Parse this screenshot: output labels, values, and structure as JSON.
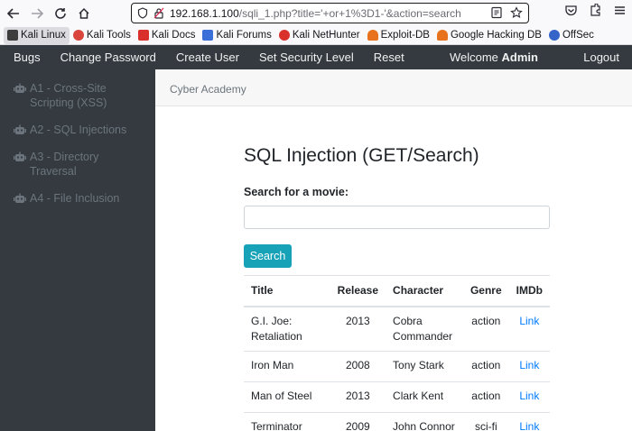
{
  "browser": {
    "url_host": "192.168.1.100",
    "url_rest": "/sqli_1.php?title='+or+1%3D1-'&action=search"
  },
  "bookmarks": [
    {
      "label": "Kali Linux",
      "color": "#3d3d3d",
      "active": true
    },
    {
      "label": "Kali Tools",
      "color": "#d9453d",
      "active": false
    },
    {
      "label": "Kali Docs",
      "color": "#d9302c",
      "active": false
    },
    {
      "label": "Kali Forums",
      "color": "#3b6fd8",
      "active": false
    },
    {
      "label": "Kali NetHunter",
      "color": "#d9302c",
      "active": false
    },
    {
      "label": "Exploit-DB",
      "color": "#e8731e",
      "active": false
    },
    {
      "label": "Google Hacking DB",
      "color": "#e8731e",
      "active": false
    },
    {
      "label": "OffSec",
      "color": "#3565c9",
      "active": false
    }
  ],
  "navbar": {
    "items": [
      "Bugs",
      "Change Password",
      "Create User",
      "Set Security Level",
      "Reset"
    ],
    "welcome_prefix": "Welcome",
    "welcome_user": "Admin",
    "logout": "Logout"
  },
  "sidebar": {
    "items": [
      "A1 - Cross-Site Scripting (XSS)",
      "A2 - SQL Injections",
      "A3 - Directory Traversal",
      "A4 - File Inclusion"
    ]
  },
  "content": {
    "header": "Cyber Academy",
    "title": "SQL Injection (GET/Search)",
    "search_label": "Search for a movie:",
    "search_value": "",
    "search_button": "Search"
  },
  "table": {
    "headers": [
      "Title",
      "Release",
      "Character",
      "Genre",
      "IMDb"
    ],
    "rows": [
      {
        "title": "G.I. Joe: Retaliation",
        "release": "2013",
        "character": "Cobra Commander",
        "genre": "action",
        "imdb": "Link"
      },
      {
        "title": "Iron Man",
        "release": "2008",
        "character": "Tony Stark",
        "genre": "action",
        "imdb": "Link"
      },
      {
        "title": "Man of Steel",
        "release": "2013",
        "character": "Clark Kent",
        "genre": "action",
        "imdb": "Link"
      },
      {
        "title": "Terminator",
        "release": "2009",
        "character": "John Connor",
        "genre": "sci-fi",
        "imdb": "Link"
      }
    ]
  }
}
